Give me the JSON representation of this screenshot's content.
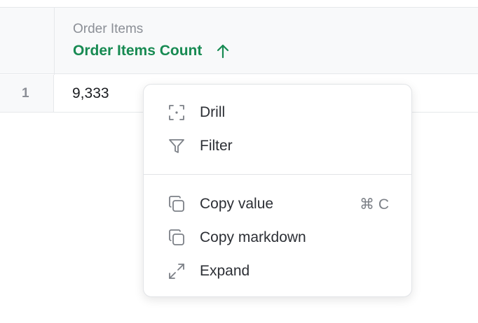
{
  "table": {
    "column": {
      "source": "Order Items",
      "name": "Order Items Count",
      "sort_icon": "arrow-up-icon"
    },
    "rows": [
      {
        "row_number": "1",
        "value": "9,333"
      }
    ]
  },
  "context_menu": {
    "items": [
      {
        "label": "Drill",
        "icon": "drill-icon"
      },
      {
        "label": "Filter",
        "icon": "filter-icon"
      },
      {
        "label": "Copy value",
        "icon": "copy-icon",
        "shortcut": "⌘ C"
      },
      {
        "label": "Copy markdown",
        "icon": "copy-icon"
      },
      {
        "label": "Expand",
        "icon": "expand-icon"
      }
    ]
  },
  "colors": {
    "accent": "#178a52",
    "header_background": "#f8f9fa",
    "border": "#e6e8eb",
    "muted_text": "#8b8f96"
  }
}
